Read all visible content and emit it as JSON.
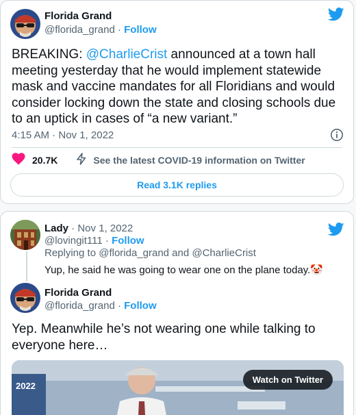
{
  "tweet1": {
    "author_name": "Florida Grand",
    "handle": "@florida_grand",
    "separator": " · ",
    "follow_label": "Follow",
    "text_prefix": "BREAKING: ",
    "text_mention": "@CharlieCrist",
    "text_line1": " announced at a town hall",
    "text_line2": "meeting yesterday that he would implement statewide",
    "text_line3": "mask and vaccine mandates for all Floridians and would",
    "text_line4": "consider locking down the state and closing schools due",
    "text_line5": "to an uptick in cases of “a new variant.”",
    "timestamp": "4:15 AM · Nov 1, 2022",
    "likes": "20.7K",
    "covid_info": "See the latest COVID-19 information on Twitter",
    "read_replies": "Read 3.1K replies"
  },
  "tweet2": {
    "author_name": "Lady",
    "date": " · Nov 1, 2022",
    "handle": "@lovingit111",
    "separator": " · ",
    "follow_label": "Follow",
    "replying_to": "Replying to @florida_grand and @CharlieCrist",
    "reply_text": "Yup, he said he was going to wear one on the plane today.",
    "reply_emoji": "🤡"
  },
  "tweet3": {
    "author_name": "Florida Grand",
    "handle": "@florida_grand",
    "separator": " · ",
    "follow_label": "Follow",
    "text_line1": "Yep. Meanwhile he’s not wearing one while talking to",
    "text_line2": "everyone here…",
    "media_badge": "2022",
    "watch_label": "Watch on Twitter"
  },
  "icons": {
    "twitter": "twitter-bird-icon",
    "like": "heart-icon",
    "info": "info-icon",
    "covid": "lightning-icon"
  },
  "colors": {
    "accent": "#1d9bf0",
    "heart": "#f91880",
    "muted": "#536471",
    "border": "#cfd9de"
  }
}
